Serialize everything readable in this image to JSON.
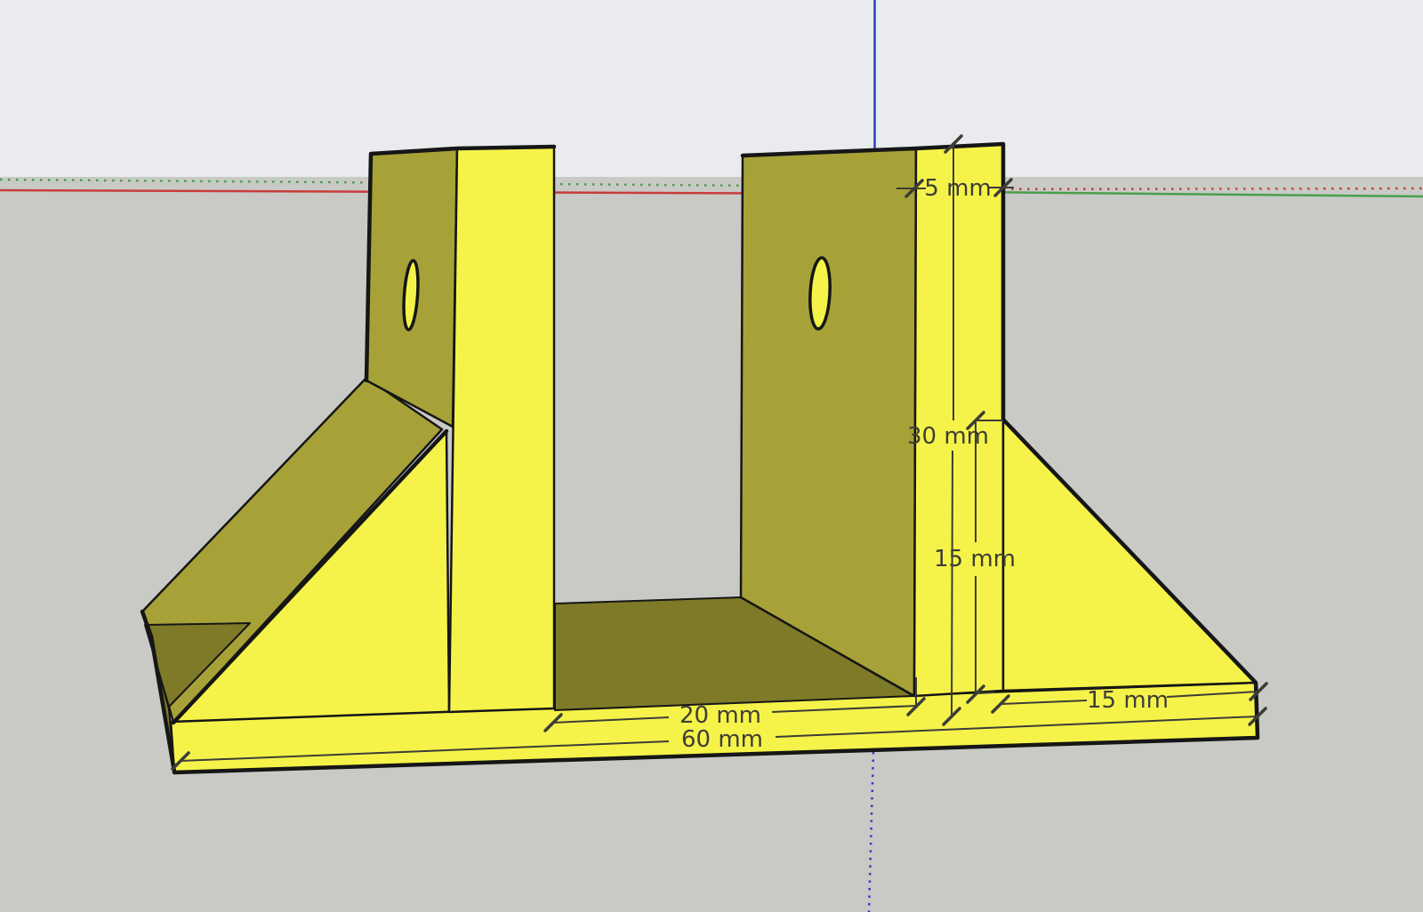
{
  "app": "3d-cad-viewport",
  "dimensions": {
    "wall_thickness": {
      "label": "5 mm"
    },
    "wall_height": {
      "label": "30 mm"
    },
    "gusset_height": {
      "label": "15 mm"
    },
    "slot_width": {
      "label": "20 mm"
    },
    "base_length": {
      "label": "60 mm"
    },
    "gusset_width": {
      "label": "15 mm"
    }
  },
  "colors": {
    "bright": "#f5f349",
    "shade": "#a7a238",
    "dark": "#7e7a28",
    "sky": "#e9ebee",
    "ground": "#c9c9c6",
    "red": "#c83c3c",
    "green": "#4a9e4a",
    "blue": "#2e3cc8",
    "edge": "#161616",
    "dim": "#3d3d37"
  }
}
